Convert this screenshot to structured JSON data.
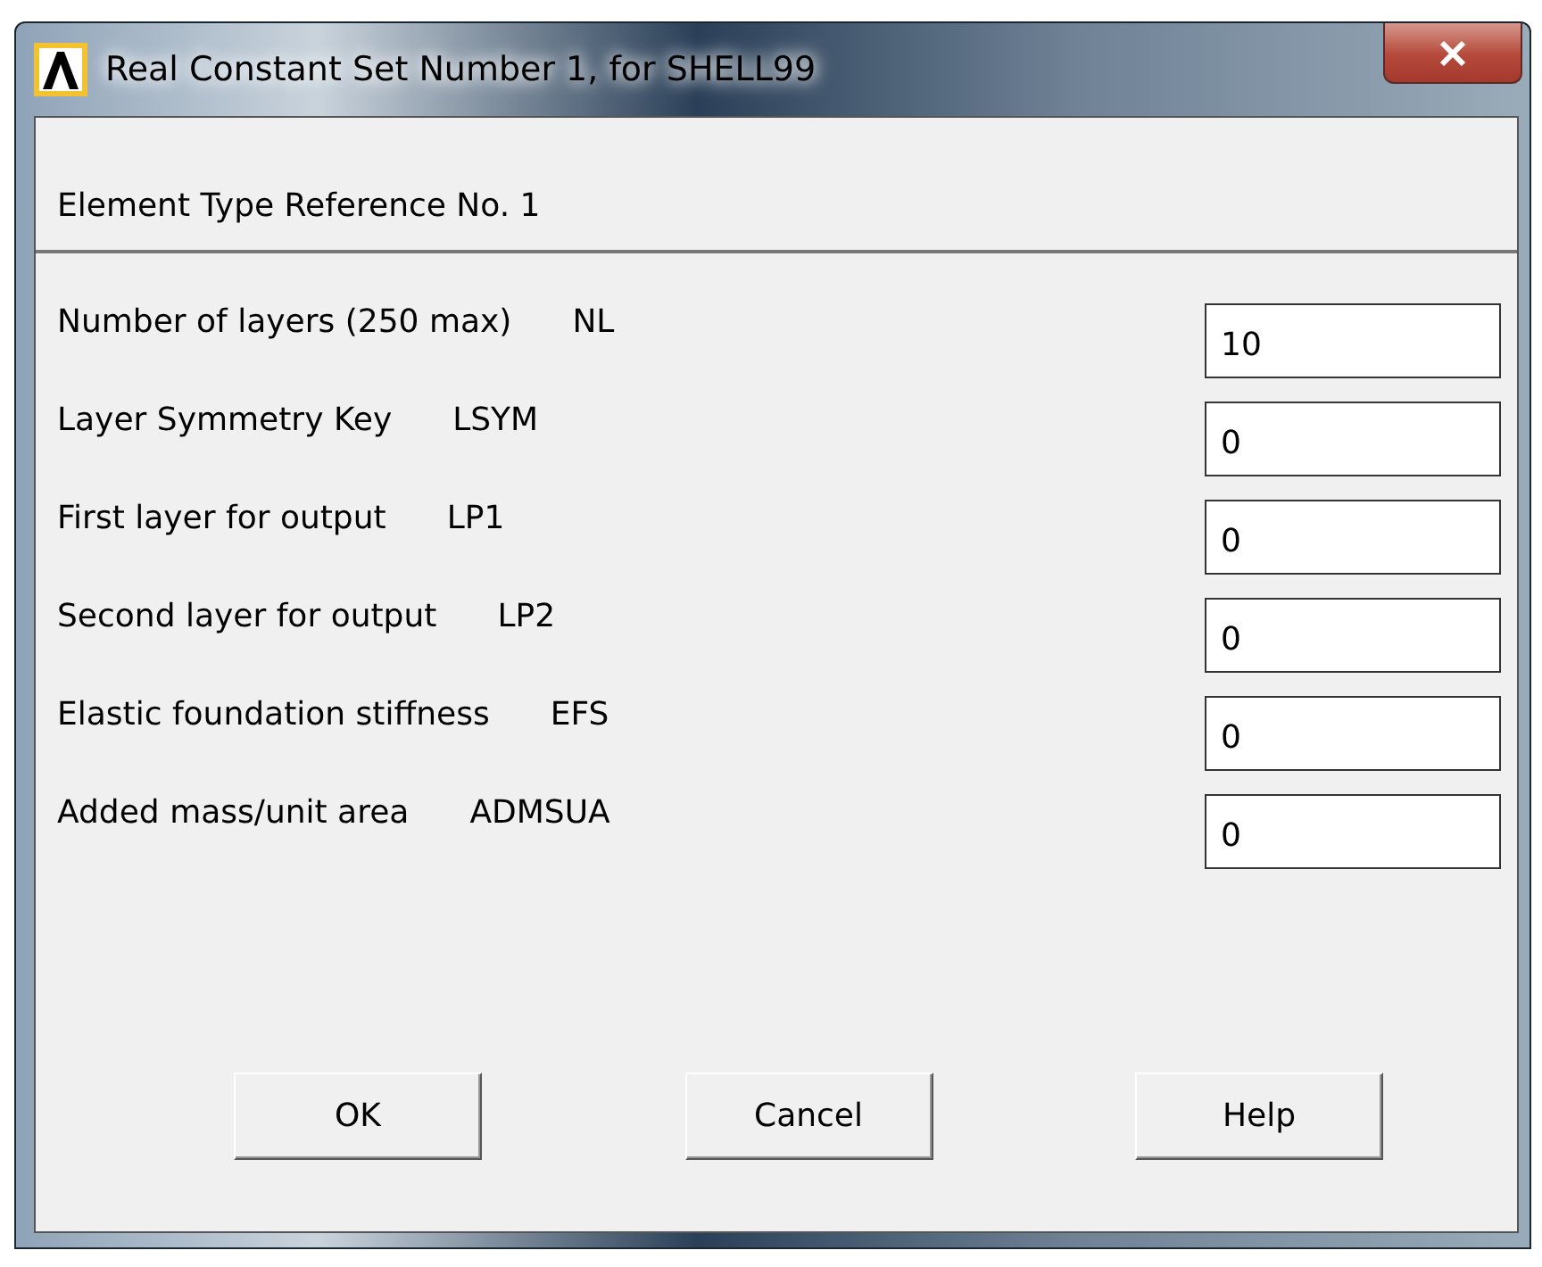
{
  "window": {
    "title": "Real Constant Set Number 1, for SHELL99"
  },
  "header": "Element Type Reference No. 1",
  "fields": [
    {
      "label": "Number of layers (250 max)",
      "keyword": "NL",
      "value": "10"
    },
    {
      "label": "Layer Symmetry Key",
      "keyword": "LSYM",
      "value": "0"
    },
    {
      "label": "First layer for output",
      "keyword": "LP1",
      "value": "0"
    },
    {
      "label": "Second layer for output",
      "keyword": "LP2",
      "value": "0"
    },
    {
      "label": "Elastic foundation stiffness",
      "keyword": "EFS",
      "value": "0"
    },
    {
      "label": "Added mass/unit area",
      "keyword": "ADMSUA",
      "value": "0"
    }
  ],
  "buttons": [
    "OK",
    "Cancel",
    "Help"
  ]
}
